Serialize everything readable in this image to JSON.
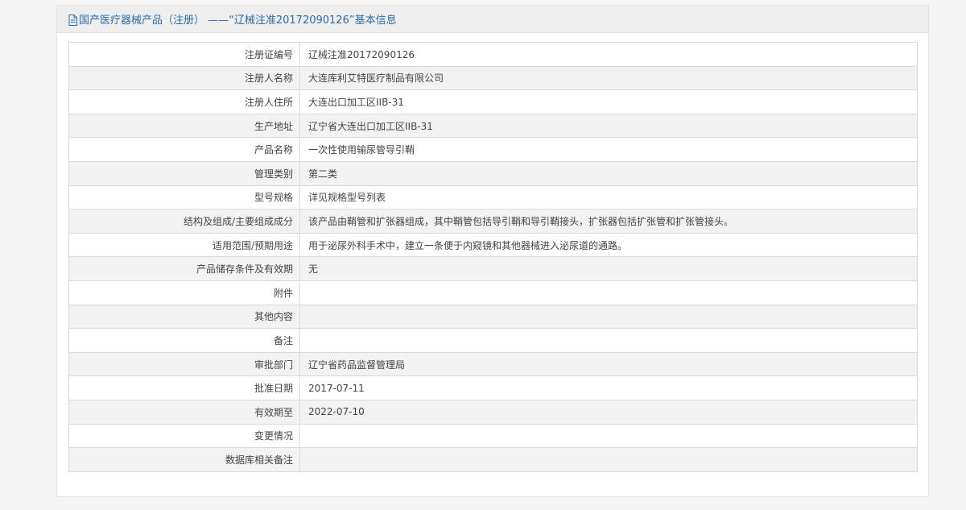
{
  "header": {
    "title": "国产医疗器械产品（注册） ——“辽械注准20172090126”基本信息",
    "icon": "document-icon",
    "accent_color": "#2e6ca6"
  },
  "rows": [
    {
      "label": "注册证编号",
      "value": "辽械注准20172090126"
    },
    {
      "label": "注册人名称",
      "value": "大连库利艾特医疗制品有限公司"
    },
    {
      "label": "注册人住所",
      "value": "大连出口加工区IIB-31"
    },
    {
      "label": "生产地址",
      "value": "辽宁省大连出口加工区IIB-31"
    },
    {
      "label": "产品名称",
      "value": "一次性使用输尿管导引鞘"
    },
    {
      "label": "管理类别",
      "value": "第二类"
    },
    {
      "label": "型号规格",
      "value": "详见规格型号列表"
    },
    {
      "label": "结构及组成/主要组成成分",
      "value": "该产品由鞘管和扩张器组成，其中鞘管包括导引鞘和导引鞘接头，扩张器包括扩张管和扩张管接头。"
    },
    {
      "label": "适用范围/预期用途",
      "value": "用于泌尿外科手术中，建立一条便于内窥镜和其他器械进入泌尿道的通路。"
    },
    {
      "label": "产品储存条件及有效期",
      "value": "无"
    },
    {
      "label": "附件",
      "value": ""
    },
    {
      "label": "其他内容",
      "value": ""
    },
    {
      "label": "备注",
      "value": ""
    },
    {
      "label": "审批部门",
      "value": "辽宁省药品监督管理局"
    },
    {
      "label": "批准日期",
      "value": "2017-07-11"
    },
    {
      "label": "有效期至",
      "value": "2022-07-10"
    },
    {
      "label": "变更情况",
      "value": ""
    },
    {
      "label": "数据库相关备注",
      "value": ""
    }
  ]
}
